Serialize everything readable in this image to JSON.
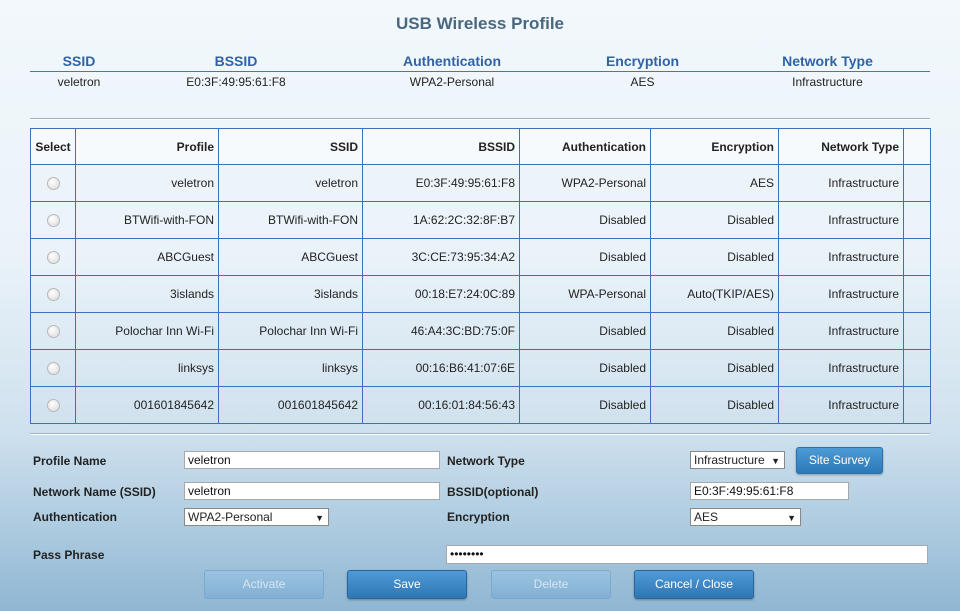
{
  "title": "USB Wireless Profile",
  "current": {
    "headers": [
      "SSID",
      "BSSID",
      "Authentication",
      "Encryption",
      "Network Type"
    ],
    "values": [
      "veletron",
      "E0:3F:49:95:61:F8",
      "WPA2-Personal",
      "AES",
      "Infrastructure"
    ]
  },
  "table": {
    "headers": [
      "Select",
      "Profile",
      "SSID",
      "BSSID",
      "Authentication",
      "Encryption",
      "Network Type"
    ],
    "rows": [
      [
        "veletron",
        "veletron",
        "E0:3F:49:95:61:F8",
        "WPA2-Personal",
        "AES",
        "Infrastructure"
      ],
      [
        "BTWifi-with-FON",
        "BTWifi-with-FON",
        "1A:62:2C:32:8F:B7",
        "Disabled",
        "Disabled",
        "Infrastructure"
      ],
      [
        "ABCGuest",
        "ABCGuest",
        "3C:CE:73:95:34:A2",
        "Disabled",
        "Disabled",
        "Infrastructure"
      ],
      [
        "3islands",
        "3islands",
        "00:18:E7:24:0C:89",
        "WPA-Personal",
        "Auto(TKIP/AES)",
        "Infrastructure"
      ],
      [
        "Polochar Inn Wi-Fi",
        "Polochar Inn Wi-Fi",
        "46:A4:3C:BD:75:0F",
        "Disabled",
        "Disabled",
        "Infrastructure"
      ],
      [
        "linksys",
        "linksys",
        "00:16:B6:41:07:6E",
        "Disabled",
        "Disabled",
        "Infrastructure"
      ],
      [
        "001601845642",
        "001601845642",
        "00:16:01:84:56:43",
        "Disabled",
        "Disabled",
        "Infrastructure"
      ]
    ]
  },
  "form": {
    "profile_name_label": "Profile Name",
    "profile_name_value": "veletron",
    "network_name_label": "Network Name (SSID)",
    "network_name_value": "veletron",
    "authentication_label": "Authentication",
    "authentication_value": "WPA2-Personal",
    "network_type_label": "Network Type",
    "network_type_value": "Infrastructure",
    "bssid_label": "BSSID(optional)",
    "bssid_value": "E0:3F:49:95:61:F8",
    "encryption_label": "Encryption",
    "encryption_value": "AES",
    "pass_phrase_label": "Pass Phrase",
    "pass_phrase_value": "••••••••",
    "site_survey_label": "Site Survey"
  },
  "buttons": {
    "activate": "Activate",
    "save": "Save",
    "delete": "Delete",
    "cancel": "Cancel / Close"
  },
  "colors": {
    "header_text": "#2f63a6",
    "table_border": "#4070b8",
    "button_active": "#2f75b4"
  }
}
